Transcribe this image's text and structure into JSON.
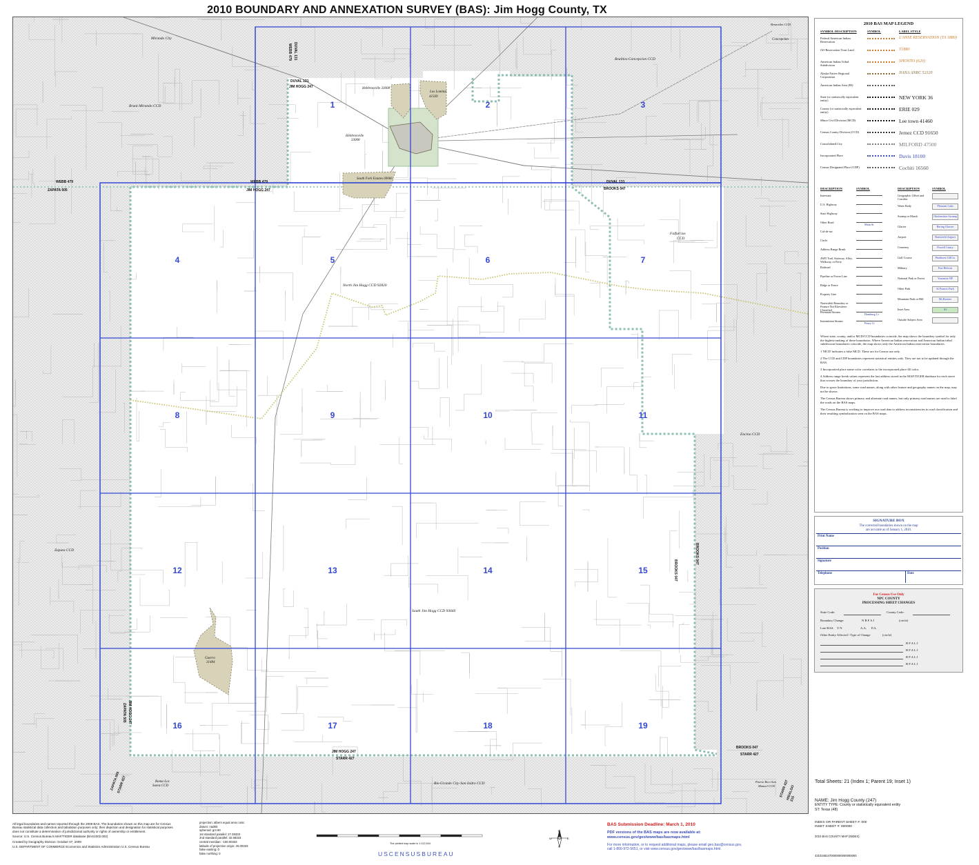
{
  "title": "2010 BOUNDARY AND ANNEXATION SURVEY (BAS): Jim Hogg County, TX",
  "sheets": [
    "1",
    "2",
    "3",
    "4",
    "5",
    "6",
    "7",
    "8",
    "9",
    "10",
    "11",
    "12",
    "13",
    "14",
    "15",
    "16",
    "17",
    "18",
    "19"
  ],
  "map_labels": {
    "mirando_city": "Mirando City",
    "bruni_mirando": "Bruni-Mirando CCD",
    "realitos": "Realitos-Concepcion CCD",
    "concepcion": "Concepcion",
    "benavides": "Benavides CCD",
    "hebbronville_33008": "Hebbronville 33008",
    "las_lomitas": "Las Lomitas",
    "las_lomitas_code": "41569",
    "hebbronville": "Hebbronville",
    "hebbronville_code": "33008",
    "south_fork": "South Fork Estates 69066",
    "north_jim_hogg": "North Jim Hogg CCD 92820",
    "falfurrias": "Falfurrias",
    "falfurrias_ccd": "CCD",
    "encino": "Encino CCD",
    "zapata_ccd": "Zapata CCD",
    "south_jim_hogg": "South Jim Hogg CCD 93660",
    "guerra": "Guerra",
    "guerra_code": "31484",
    "roma": "Roma-Los",
    "roma2": "Saenz CCD",
    "rio_grande": "Rio Grande City-San Isidro CCD",
    "puerto_rico": "Puerto Rico-San",
    "puerto_rico2": "Manuel CCD",
    "duval131_a": "DUVAL 131",
    "jimhogg247_a": "JIM HOGG 247",
    "webb479_a": "WEBB 479",
    "zapata505": "ZAPATA 505",
    "webb479_b": "WEBB 479",
    "jimhogg247_b": "JIM HOGG 247",
    "duval131_b": "DUVAL 131",
    "brooks047_a": "BROOKS 047",
    "brooks047_b": "BROOKS 047",
    "starr427_a": "STARR 427",
    "jimhogg247_c": "JIM HOGG 247",
    "starr427_b": "STARR 427",
    "brooks047_c": "BROOKS 047",
    "starr427_c": "STARR 427",
    "hidalgo215": "HIDALGO 215",
    "zapata505_b": "ZAPATA 505",
    "starr427_d": "STARR 427",
    "jimhogg247_d": "JIM HOGG 247",
    "zapata505_c": "ZAPATA 505",
    "duval131_c": "DUVAL 131",
    "webb479_c": "WEBB 479",
    "brooks047_d": "BROOKS 047"
  },
  "legend": {
    "title": "2010 BAS MAP LEGEND",
    "col_desc": "SYMBOL DESCRIPTION",
    "col_sym": "SYMBOL",
    "col_label": "LABEL STYLE",
    "rows": [
      {
        "desc": "Federal American Indian Reservation",
        "label": "L'ANSE RESERVATION (TA 1880)",
        "color": "#c77b2c"
      },
      {
        "desc": "Off-Reservation Trust Land",
        "label": "T1880",
        "color": "#c77b2c"
      },
      {
        "desc": "American Indian Tribal Subdivision",
        "label": "SHONTO (620)",
        "color": "#c77b2c"
      },
      {
        "desc": "Alaska Native Regional Corporation",
        "label": "NANA ANRC 52120",
        "color": "#8a6a33"
      },
      {
        "desc": "American Indian Area (BI)",
        "label": "",
        "color": "#555555"
      },
      {
        "desc": "State (or statistically equivalent entity)",
        "label": "NEW YORK 36",
        "color": "#111111"
      },
      {
        "desc": "County (or statistically equivalent entity)",
        "label": "ERIE 029",
        "color": "#111111"
      },
      {
        "desc": "Minor Civil Division (MCD)",
        "label": "Lee town 41460",
        "color": "#111111"
      },
      {
        "desc": "Census County Division (CCD)",
        "label": "Jemez CCD 91650",
        "color": "#333333"
      },
      {
        "desc": "Consolidated City",
        "label": "MILFORD 47500",
        "color": "#777777"
      },
      {
        "desc": "Incorporated Place",
        "label": "Davis 18100",
        "color": "#3b4bb8"
      },
      {
        "desc": "Census Designated Place (CDP)",
        "label": "Cochiti 16560",
        "color": "#555555"
      }
    ],
    "col2_desc": "DESCRIPTION",
    "col2_sym": "SYMBOL",
    "left2": [
      "Interstate",
      "U.S. Highway",
      "State Highway",
      "Other Road",
      "Cul-de-sac",
      "Circle",
      "Address Range Break",
      "4WD Trail, Stairway, Alley, Walkway, or Ferry",
      "Railroad",
      "Pipeline or Power Line",
      "Ridge or Fence",
      "Property Line",
      "Nonvisible Boundary or Feature Not Elsewhere Classified",
      "Perennial Stream",
      "Intermittent Stream"
    ],
    "left2_samples": [
      "",
      "",
      "",
      "Main St",
      "",
      "",
      "",
      "",
      "",
      "",
      "",
      "",
      "",
      "Hamburg Cr",
      "Piney Cr"
    ],
    "right2": [
      "Geographic Offset and Corridor",
      "Water Body",
      "Swamp or Marsh",
      "Glacier",
      "Airport",
      "Cemetery",
      "Golf Course",
      "Military",
      "National Park or Forest",
      "Other Park",
      "Mountain Peak or Hill",
      "Inset Area",
      "Outside Subject Area"
    ],
    "right2_samples": [
      "",
      "Pleasant Lake",
      "Okefenokee Swamp",
      "Bering Glacier",
      "Hartsfield Airport",
      "Powell Cmtry",
      "Pinehurst GlfCrs",
      "Fort Belvoir",
      "Yosemite NP",
      "St Francis Park",
      "Mt Rainier",
      "A1",
      ""
    ],
    "notes": [
      "Where state, county, and/or MCD/CCD boundaries coincide, the map shows the boundary symbol for only the highest-ranking of these boundaries. Where American Indian reservation and American Indian tribal subdivision boundaries coincide, the map shows only the American Indian reservation boundaries.",
      "1 'MCD' indicates a false MCD. These are for Census use only.",
      "2 The CCD and CDP boundaries represent statistical entities only. They are not to be updated through the BAS.",
      "3 Incorporated place name color correlates to the incorporated place fill color.",
      "4 Address range break values represent the last address stored in the MAF/TIGER database for each street that crosses the boundary of your jurisdiction.",
      "Due to space limitations, some road names, along with other feature and geography names on the map, may not be shown.",
      "The Census Bureau shows primary and alternate road names, but only primary road names are used to label the roads on the BAS maps.",
      "The Census Bureau is working to improve our road data to address inconsistencies in road classification and their resulting symbolization seen on the BAS maps."
    ]
  },
  "signature": {
    "header": "SIGNATURE BOX",
    "sub1": "The corrected boundaries shown on the map",
    "sub2": "are accurate as of January 1, 2010.",
    "print_name": "Print Name",
    "position": "Position",
    "signature": "Signature",
    "telephone": "Telephone",
    "date": "Date"
  },
  "census_use": {
    "header": "For Census Use Only",
    "sub1": "NPC COUNTY",
    "sub2": "PROCESSING SHEET CHANGES",
    "state_code": "State Code:",
    "county_code": "County Code:",
    "boundary_change": "Boundary Change:",
    "bc_opts": "N   B   F   A   J",
    "circle": "(circle)",
    "late_bas": "Late BAS:",
    "late_opts": "Y   N",
    "aa": "A,A,",
    "pa": "P,A,",
    "other_entity": "Other Entity Affected / Type of Change",
    "row_opts": "B   F   A   L   J"
  },
  "bottom": {
    "total_sheets": "Total Sheets: 21 (Index 1; Parent 19; Inset 1)",
    "name": "NAME: Jim Hogg County (247)",
    "entity_type": "ENTITY TYPE: County or statistically equivalent entity",
    "st": "ST: Texas (48)",
    "index_parent": "INDEX OR PARENT SHEET #: 000",
    "inset": "INSET SHEET #: 000000",
    "map_id": "2010 BAS COUNTY MAP (INDEX)",
    "barcode": "43102482470000000000000000",
    "left_notes": [
      "All legal boundaries and names reported through the 2009 BAS. The boundaries shown on this map are for Census Bureau statistical data collection and tabulation purposes only; their depiction and designation for statistical purposes does not constitute a determination of jurisdictional authority or rights of ownership or entitlement.",
      "Source: U.S. Census Bureau's MAF/TIGER database (BAS1002.002)",
      "Created by Geography Division: October 07, 2009",
      "U.S. DEPARTMENT OF COMMERCE Economics and Statistics Administration U.S. Census Bureau"
    ],
    "projection": [
      "projection: albers equal area conic",
      "datum: nad83",
      "spheroid: grs 80",
      "1st standard parallel: 27.38333",
      "2nd standard parallel: 32.58333",
      "central meridian: -100.00333",
      "latitude of projection origin: 25.00333",
      "false easting: 0",
      "false northing: 0"
    ],
    "deadline": "BAS Submission Deadline: March 1, 2010",
    "pdf1": "PDF versions of the BAS maps are now available at:",
    "pdf2": "www.census.gov/geo/www/bas/basmaps.html",
    "more1": "For more information, or to request additional maps, please email geo.bas@census.gov,",
    "more2": "call 1-800-972-5651, or visit www.census.gov/geo/www/bas/basmaps.html.",
    "bureau": "USCENSUSBUREAU",
    "scale_note": "The plotted map scale is 1:112,544"
  }
}
